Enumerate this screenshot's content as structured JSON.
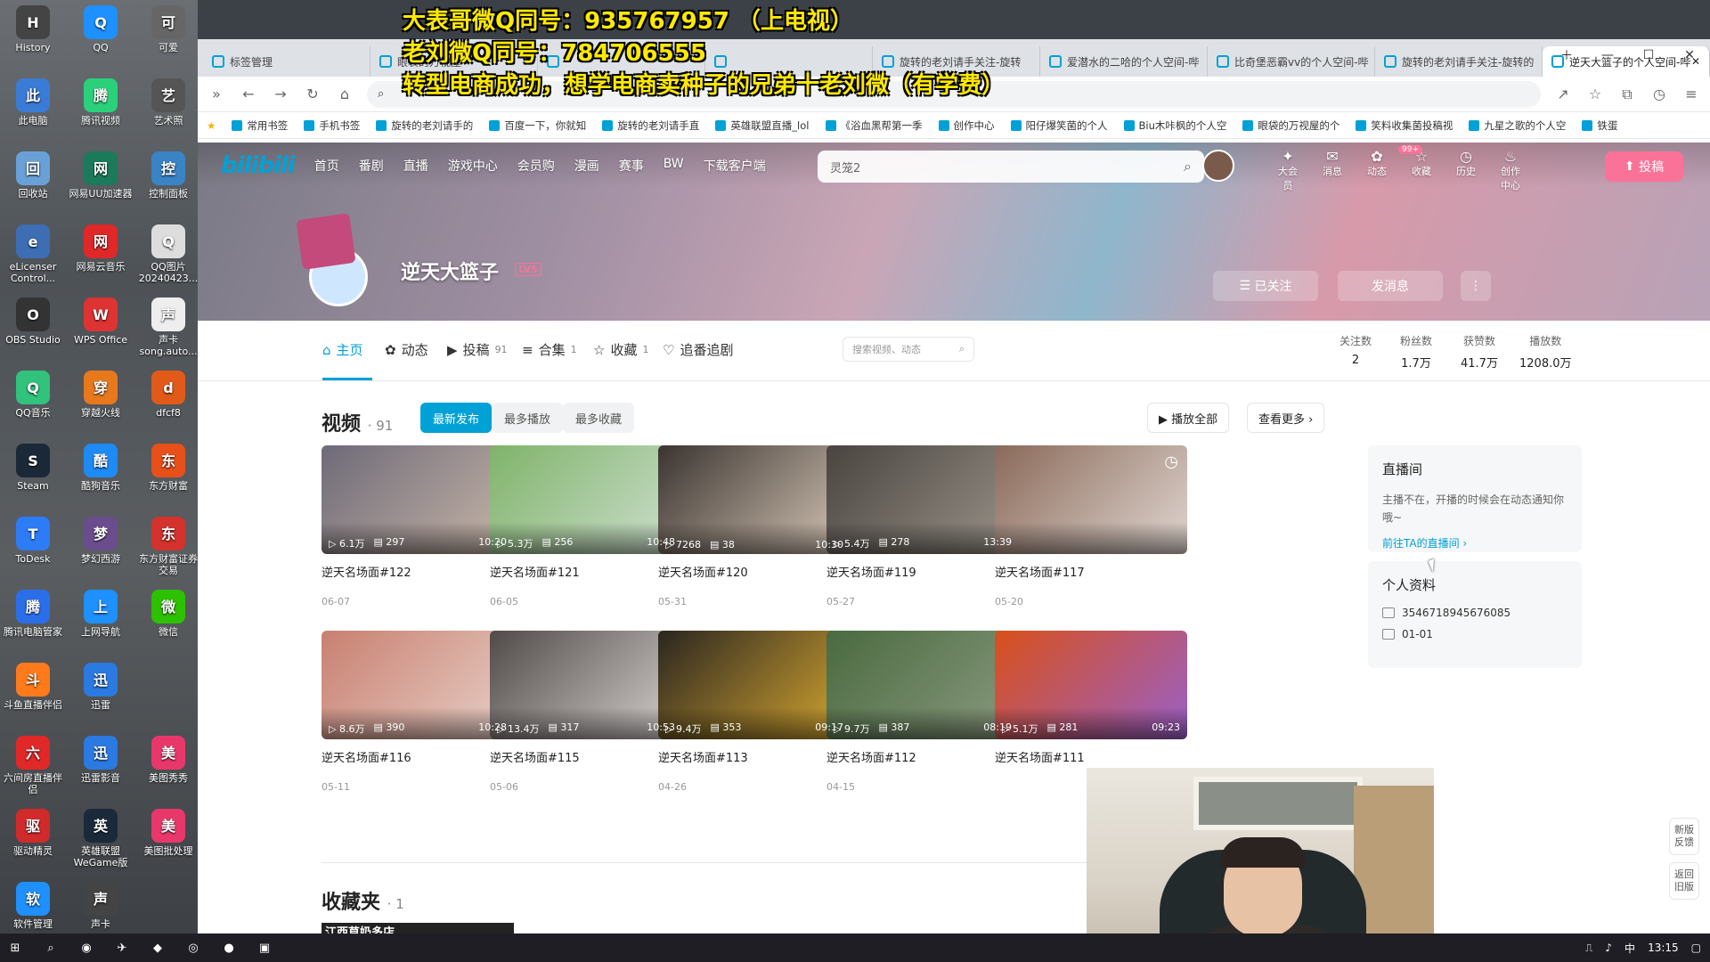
{
  "overlay": {
    "lines": [
      "大表哥微Q同号：935767957 （上电视）",
      "老刘微Q同号：784706555",
      "转型电商成功，想学电商卖种子的兄弟十老刘微（有学费）"
    ]
  },
  "desktop": {
    "icons": [
      {
        "label": "History",
        "color": "#444"
      },
      {
        "label": "QQ",
        "color": "#1e90ff"
      },
      {
        "label": "可爱",
        "color": "#666"
      },
      {
        "label": "此电脑",
        "color": "#3a7bd5"
      },
      {
        "label": "腾讯视频",
        "color": "#2ad17a"
      },
      {
        "label": "艺术照",
        "color": "#555"
      },
      {
        "label": "回收站",
        "color": "#6aa0d8"
      },
      {
        "label": "网易UU加速器",
        "color": "#1b7a5a"
      },
      {
        "label": "控制面板",
        "color": "#3a84c6"
      },
      {
        "label": "eLicenser Control...",
        "color": "#3d6db3"
      },
      {
        "label": "网易云音乐",
        "color": "#e02828"
      },
      {
        "label": "QQ图片20240423...",
        "color": "#ddd"
      },
      {
        "label": "OBS Studio",
        "color": "#333"
      },
      {
        "label": "WPS Office",
        "color": "#d33"
      },
      {
        "label": "声卡song.auto...",
        "color": "#eee"
      },
      {
        "label": "QQ音乐",
        "color": "#31c27c"
      },
      {
        "label": "穿越火线",
        "color": "#e8781c"
      },
      {
        "label": "dfcf8",
        "color": "#e25a1a"
      },
      {
        "label": "Steam",
        "color": "#1b2838"
      },
      {
        "label": "酷狗音乐",
        "color": "#1e8bf5"
      },
      {
        "label": "东方财富",
        "color": "#e8501a"
      },
      {
        "label": "ToDesk",
        "color": "#2d7bf5"
      },
      {
        "label": "梦幻西游",
        "color": "#6a4d8c"
      },
      {
        "label": "东方财富证券交易",
        "color": "#d4322c"
      },
      {
        "label": "腾讯电脑管家",
        "color": "#2b6fe8"
      },
      {
        "label": "上网导航",
        "color": "#1e90ff"
      },
      {
        "label": "微信",
        "color": "#2dc100"
      },
      {
        "label": "斗鱼直播伴侣",
        "color": "#ff7a1a"
      },
      {
        "label": "迅雷",
        "color": "#2a7ae2"
      },
      {
        "label": "六间房直播伴侣",
        "color": "#e02828"
      },
      {
        "label": "迅雷影音",
        "color": "#2a7ae2"
      },
      {
        "label": "美图秀秀",
        "color": "#e8386b"
      },
      {
        "label": "驱动精灵",
        "color": "#d02a2a"
      },
      {
        "label": "英雄联盟WeGame版",
        "color": "#1a2a3a"
      },
      {
        "label": "美图批处理",
        "color": "#e8386b"
      },
      {
        "label": "软件管理",
        "color": "#1e90ff"
      },
      {
        "label": "声卡",
        "color": "#444"
      }
    ]
  },
  "browser": {
    "tabs": [
      "标签管理",
      "眼袋的万视屋",
      "",
      "",
      "旋转的老刘请手关注-旋转",
      "爱潜水的二哈的个人空间-哔",
      "比奇堡恶霸vv的个人空间-哔",
      "旋转的老刘请手关注-旋转的",
      "逆天大篮子的个人空间-哔"
    ],
    "bookmarks": [
      "常用书签",
      "手机书签",
      "旋转的老刘请手的",
      "百度一下，你就知",
      "旋转的老刘请手直",
      "英雄联盟直播_lol",
      "《浴血黑帮第一季",
      "创作中心",
      "阳仔爆笑菌的个人",
      "Biu木咔枫的个人空",
      "眼袋的万视屋的个",
      "笑料收集菌投稿视",
      "九星之歌的个人空",
      "铁蛋"
    ]
  },
  "bili": {
    "logo": "bilibili",
    "nav": [
      "首页",
      "番剧",
      "直播",
      "游戏中心",
      "会员购",
      "漫画",
      "赛事",
      "BW",
      "下载客户端"
    ],
    "search_placeholder": "灵笼2",
    "rnav": [
      {
        "g": "✦",
        "l": "大会员"
      },
      {
        "g": "✉",
        "l": "消息"
      },
      {
        "g": "✿",
        "l": "动态"
      },
      {
        "g": "☆",
        "l": "收藏"
      },
      {
        "g": "◷",
        "l": "历史"
      },
      {
        "g": "♨",
        "l": "创作中心"
      }
    ],
    "badge": "99+",
    "upload": "投稿",
    "user": {
      "name": "逆天大篮子",
      "level": "LV5"
    },
    "follow_btn": "已关注",
    "msg_btn": "发消息",
    "more_btn": "⋮",
    "tabs": [
      {
        "icon": "⌂",
        "label": "主页",
        "n": ""
      },
      {
        "icon": "✿",
        "label": "动态",
        "n": ""
      },
      {
        "icon": "▶",
        "label": "投稿",
        "n": "91"
      },
      {
        "icon": "≡",
        "label": "合集",
        "n": "1"
      },
      {
        "icon": "☆",
        "label": "收藏",
        "n": "1"
      },
      {
        "icon": "♡",
        "label": "追番追剧",
        "n": ""
      }
    ],
    "search_small": "搜索视频、动态",
    "stats": [
      {
        "l": "关注数",
        "v": "2"
      },
      {
        "l": "粉丝数",
        "v": "1.7万"
      },
      {
        "l": "获赞数",
        "v": "41.7万"
      },
      {
        "l": "播放数",
        "v": "1208.0万"
      }
    ],
    "videos_title": "视频",
    "videos_count": "· 91",
    "filters": [
      "最新发布",
      "最多播放",
      "最多收藏"
    ],
    "play_all": "▶ 播放全部",
    "see_more": "查看更多 ›",
    "videos": [
      {
        "title": "逆天名场面#122",
        "date": "06-07",
        "views": "6.1万",
        "danmu": "297",
        "dur": "10:20",
        "c1": "#6e6a78",
        "c2": "#c8b6a8"
      },
      {
        "title": "逆天名场面#121",
        "date": "06-05",
        "views": "5.3万",
        "danmu": "256",
        "dur": "10:48",
        "c1": "#7fb36a",
        "c2": "#cfe0d0"
      },
      {
        "title": "逆天名场面#120",
        "date": "05-31",
        "views": "7268",
        "danmu": "38",
        "dur": "10:30",
        "c1": "#3a3430",
        "c2": "#d8c8b8"
      },
      {
        "title": "逆天名场面#119",
        "date": "05-27",
        "views": "5.4万",
        "danmu": "278",
        "dur": "13:39",
        "c1": "#4a4440",
        "c2": "#9a948a"
      },
      {
        "title": "逆天名场面#117",
        "date": "05-20",
        "views": "",
        "danmu": "",
        "dur": "",
        "c1": "#8a6a5a",
        "c2": "#e0d6d0"
      },
      {
        "title": "逆天名场面#116",
        "date": "05-11",
        "views": "8.6万",
        "danmu": "390",
        "dur": "10:28",
        "c1": "#c88070",
        "c2": "#e8d0c8"
      },
      {
        "title": "逆天名场面#115",
        "date": "05-06",
        "views": "13.4万",
        "danmu": "317",
        "dur": "10:53",
        "c1": "#504a48",
        "c2": "#d8d2d0"
      },
      {
        "title": "逆天名场面#113",
        "date": "04-26",
        "views": "9.4万",
        "danmu": "353",
        "dur": "09:17",
        "c1": "#2a2620",
        "c2": "#d8a830"
      },
      {
        "title": "逆天名场面#112",
        "date": "04-15",
        "views": "9.7万",
        "danmu": "387",
        "dur": "08:19",
        "c1": "#4a6a40",
        "c2": "#8a9a80"
      },
      {
        "title": "逆天名场面#111",
        "date": "",
        "views": "5.1万",
        "danmu": "281",
        "dur": "09:23",
        "c1": "#d8501a",
        "c2": "#9a60c8"
      }
    ],
    "live_title": "直播间",
    "live_text": "主播不在，开播的时候会在动态通知你哦~",
    "live_link": "前往TA的直播间 ›",
    "profile_title": "个人资料",
    "uid": "3546718945676085",
    "birthday": "01-01",
    "fav_title": "收藏夹",
    "fav_count": "· 1",
    "fav_thumb_text": "江西草奶多店",
    "float_btns": [
      "新版反馈",
      "返回旧版"
    ]
  },
  "taskbar": {
    "time": "13:15",
    "lang": "中"
  }
}
